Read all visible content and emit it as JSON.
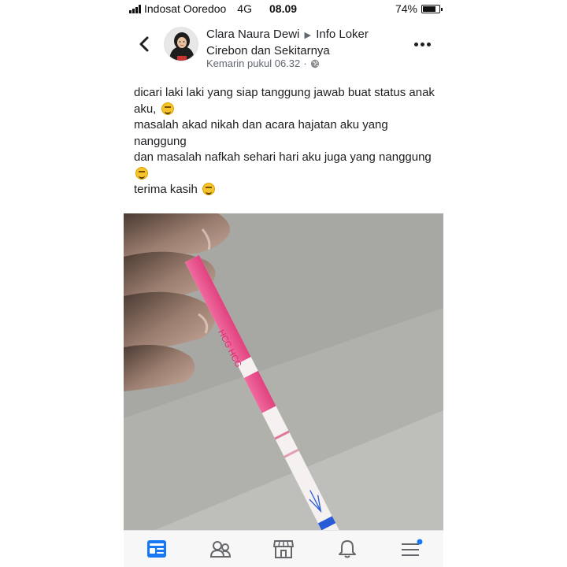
{
  "status_bar": {
    "carrier": "Indosat Ooredoo",
    "network": "4G",
    "time": "08.09",
    "battery_percent": "74%",
    "battery_level": 0.74
  },
  "post": {
    "author": "Clara Naura Dewi",
    "group": "Info Loker Cirebon dan Sekitarnya",
    "timestamp": "Kemarin pukul 06.32",
    "privacy_icon": "globe-icon",
    "lines": [
      "dicari laki laki yang siap tanggung jawab buat status anak aku,",
      "masalah akad nikah dan acara hajatan aku yang nanggung",
      "dan masalah nafkah sehari hari aku juga yang nanggung",
      "terima kasih"
    ],
    "emojis": [
      "smiling-face-icon",
      "smiling-face-icon",
      "winking-face-icon"
    ],
    "photo": {
      "strip_text": "HCG HCG"
    }
  },
  "nav": {
    "items": [
      "news-feed-icon",
      "groups-icon",
      "marketplace-icon",
      "notifications-icon",
      "menu-icon"
    ],
    "active": "news-feed-icon",
    "accent_color": "#1877f2",
    "inactive_color": "#65676b"
  },
  "colors": {
    "strip_pink": "#e94f8c",
    "marker_blue": "#2a5bd7"
  }
}
